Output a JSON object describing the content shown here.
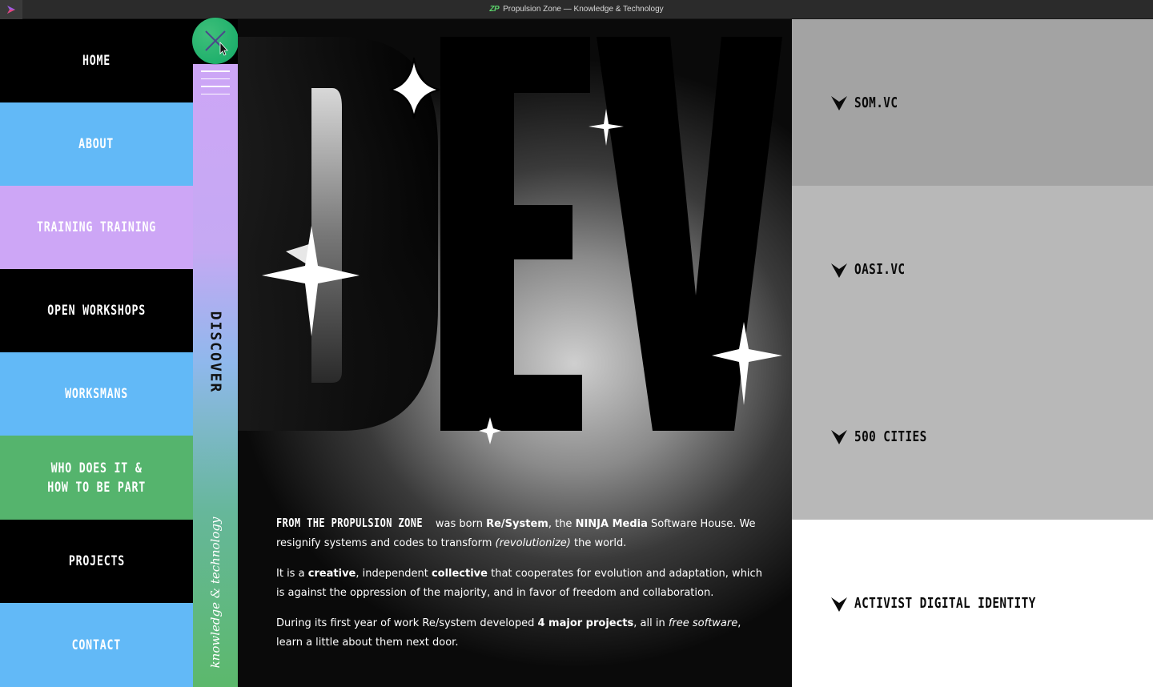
{
  "window": {
    "title_logo": "ZP",
    "title": "Propulsion Zone — Knowledge & Technology"
  },
  "nav": {
    "items": [
      {
        "label": "HOME",
        "color": "#000000"
      },
      {
        "label": "ABOUT",
        "color": "#62b9f7"
      },
      {
        "label": "TRAINING TRAINING",
        "color": "#cda6f6"
      },
      {
        "label": "OPEN WORKSHOPS",
        "color": "#000000"
      },
      {
        "label": "WORKSMANS",
        "color": "#62b9f7"
      },
      {
        "label": "WHO DOES IT &\nHOW TO BE PART",
        "color": "#55b46d"
      },
      {
        "label": "PROJECTS",
        "color": "#000000"
      },
      {
        "label": "CONTACT",
        "color": "#62b9f7"
      }
    ]
  },
  "strip": {
    "discover": "DISCOVER",
    "tagline": "knowledge & technology"
  },
  "hero": {
    "big_word": "DEV",
    "lead": "FROM THE PROPULSION ZONE",
    "p1_a": " was born ",
    "p1_b": "Re/System",
    "p1_c": ", the ",
    "p1_d": "NINJA Media",
    "p1_e": " Software House. We resignify systems and codes to transform ",
    "p1_f": "(revolutionize)",
    "p1_g": " the world.",
    "p2_a": "It is a ",
    "p2_b": "creative",
    "p2_c": ", independent ",
    "p2_d": "collective",
    "p2_e": " that cooperates for evolution and adaptation, which is against the oppression of the majority, and in favor of freedom and collaboration.",
    "p3_a": "During its first year of work Re/system developed ",
    "p3_b": "4 major projects",
    "p3_c": ", all in ",
    "p3_d": "free software",
    "p3_e": ", learn a little about them next door."
  },
  "projects": {
    "items": [
      {
        "label": "SOM.VC",
        "color": "#a3a3a3"
      },
      {
        "label": "OASI.VC",
        "color": "#b8b8b8"
      },
      {
        "label": "500 CITIES",
        "color": "#b8b8b8"
      },
      {
        "label": "ACTIVIST DIGITAL IDENTITY",
        "color": "#ffffff"
      }
    ]
  }
}
